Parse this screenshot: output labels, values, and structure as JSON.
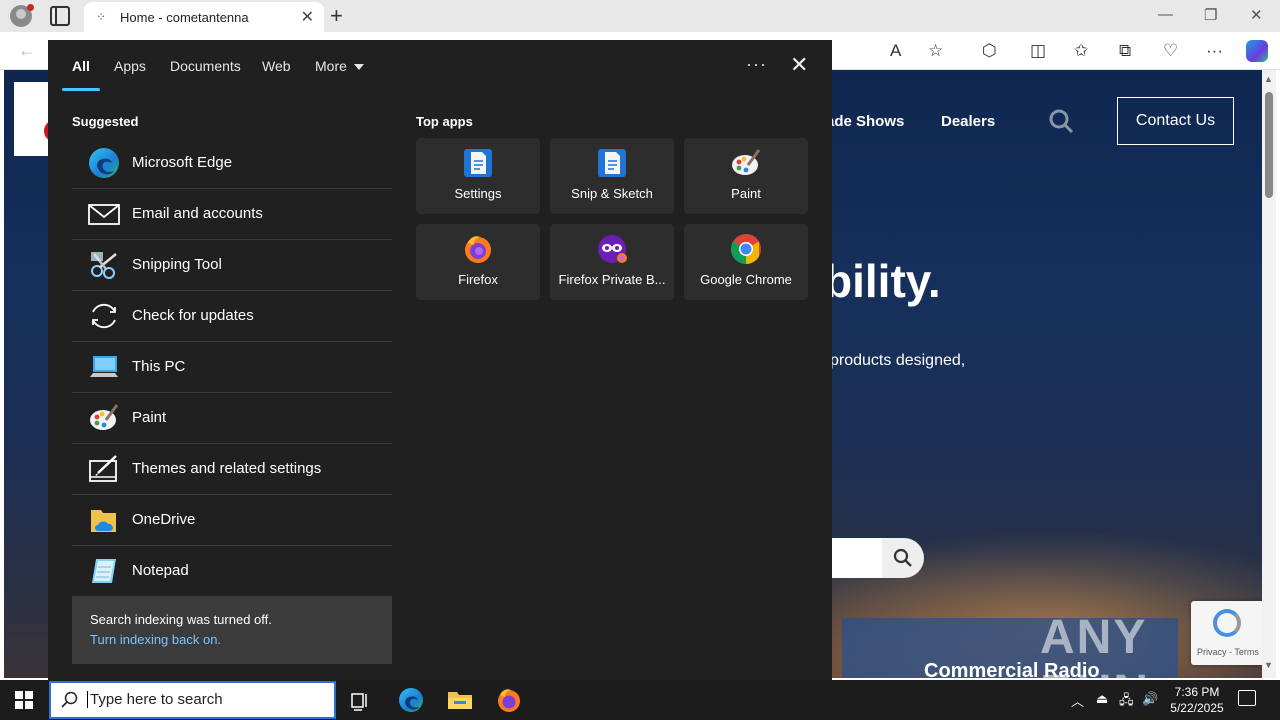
{
  "browser": {
    "tab_title": "Home - cometantenna",
    "new_tab_symbol": "+",
    "tab_close_symbol": "✕",
    "minimize_symbol": "—",
    "restore_symbol": "❐",
    "close_symbol": "✕",
    "back_symbol": "←",
    "read_aloud_symbol": "A",
    "favorite_symbol": "☆",
    "extensions_symbol": "⬡",
    "split_symbol": "◫",
    "favorites_symbol": "✩",
    "collections_symbol": "⧉",
    "performance_symbol": "♡",
    "settings_symbol": "···"
  },
  "website": {
    "nav": [
      "ade Shows",
      "Dealers"
    ],
    "contact_label": "Contact Us",
    "hero_title": "bility.",
    "hero_sub": "products designed,",
    "promo_label": "Commercial Radio",
    "watermark": "ANY RUN",
    "recaptcha_text": "Privacy - Terms"
  },
  "panel": {
    "tabs": [
      "All",
      "Apps",
      "Documents",
      "Web",
      "More"
    ],
    "ellipsis": "···",
    "close_symbol": "✕",
    "suggested_title": "Suggested",
    "suggested": [
      {
        "label": "Microsoft Edge",
        "icon": "edge-icon"
      },
      {
        "label": "Email and accounts",
        "icon": "mail-icon"
      },
      {
        "label": "Snipping Tool",
        "icon": "snipping-tool-icon"
      },
      {
        "label": "Check for updates",
        "icon": "refresh-icon"
      },
      {
        "label": "This PC",
        "icon": "computer-icon"
      },
      {
        "label": "Paint",
        "icon": "paint-icon"
      },
      {
        "label": "Themes and related settings",
        "icon": "themes-icon"
      },
      {
        "label": "OneDrive",
        "icon": "onedrive-icon"
      },
      {
        "label": "Notepad",
        "icon": "notepad-icon"
      }
    ],
    "notice_text": "Search indexing was turned off.",
    "notice_link": "Turn indexing back on.",
    "top_apps_title": "Top apps",
    "top_apps": [
      {
        "label": "Settings",
        "icon": "settings-doc-icon"
      },
      {
        "label": "Snip & Sketch",
        "icon": "snip-sketch-icon"
      },
      {
        "label": "Paint",
        "icon": "paint-icon"
      },
      {
        "label": "Firefox",
        "icon": "firefox-icon"
      },
      {
        "label": "Firefox Private B...",
        "icon": "firefox-private-icon"
      },
      {
        "label": "Google Chrome",
        "icon": "chrome-icon"
      }
    ]
  },
  "taskbar": {
    "search_placeholder": "Type here to search",
    "time": "7:36 PM",
    "date": "5/22/2025"
  },
  "colors": {
    "panel_bg": "#202020",
    "accent": "#4cc2ff",
    "link": "#79c4ff",
    "taskbar": "#1c1c1c"
  }
}
